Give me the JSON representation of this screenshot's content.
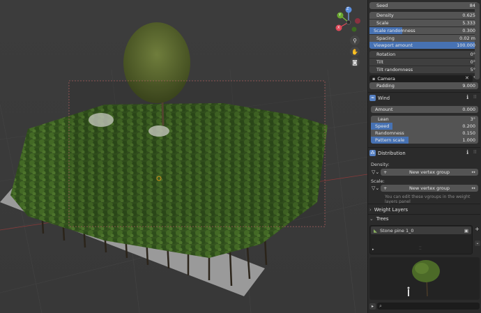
{
  "viewport": {
    "gizmo": {
      "z": "Z",
      "y": "Y",
      "x": "X"
    },
    "nav_buttons": [
      "search-plus-icon",
      "hand-icon",
      "camera-icon"
    ]
  },
  "panel": {
    "seed": {
      "label": "Seed",
      "value": "84"
    },
    "density": {
      "label": "Density",
      "value": "0.625"
    },
    "scale": {
      "label": "Scale",
      "value": "5.333"
    },
    "scale_randomness": {
      "label": "Scale randomness",
      "value": "0.300",
      "fill": 0.3
    },
    "spacing": {
      "label": "Spacing",
      "value": "0.02 m"
    },
    "viewport_amount": {
      "label": "Viewport amount",
      "value": "100.000",
      "fill": 1.0
    },
    "rotation": {
      "label": "Rotation",
      "value": "0°"
    },
    "tilt": {
      "label": "Tilt",
      "value": "0°"
    },
    "tilt_randomness": {
      "label": "Tilt randomness",
      "value": "5°"
    },
    "camera": {
      "label": "Camera"
    },
    "padding": {
      "label": "Padding",
      "value": "9.000"
    },
    "wind": {
      "title": "Wind",
      "amount": {
        "label": "Amount",
        "value": "0.000"
      },
      "lean": {
        "label": "Lean",
        "value": "3°"
      },
      "speed": {
        "label": "Speed",
        "value": "0.200",
        "fill": 0.2
      },
      "randomness": {
        "label": "Randomness",
        "value": "0.150"
      },
      "pattern_scale": {
        "label": "Pattern scale",
        "value": "1.000",
        "fill": 0.35
      }
    },
    "distribution": {
      "title": "Distribution",
      "density_label": "Density:",
      "density_group": "New vertex group",
      "scale_label": "Scale:",
      "scale_group": "New vertex group",
      "hint": "You can edit these vgroups in the weight layers panel"
    },
    "weight_layers": {
      "title": "Weight Layers"
    },
    "trees": {
      "title": "Trees",
      "item": "Stone pine 1_0"
    }
  },
  "colors": {
    "accent": "#4772b3",
    "panel_bg": "#2b2b2b",
    "field_bg": "#545454"
  }
}
